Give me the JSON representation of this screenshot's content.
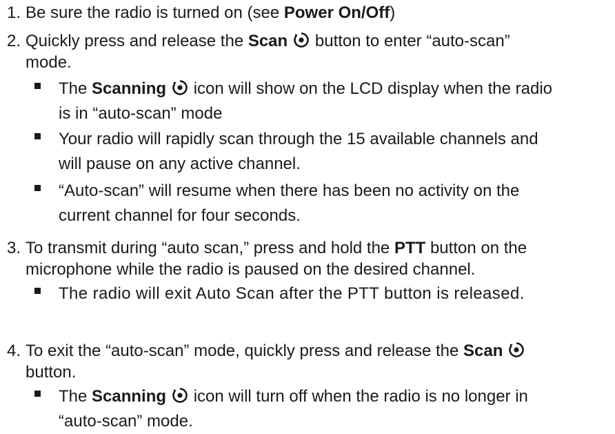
{
  "steps": [
    {
      "num": "1.",
      "pre": "Be sure the radio is turned on (see ",
      "bold": "Power On/Off",
      "post": ")"
    },
    {
      "num": "2.",
      "pre": "Quickly press and release the ",
      "bold": "Scan",
      "post": " button to enter “auto-scan”",
      "line2": "mode."
    },
    {
      "num": "3.",
      "line1": "To transmit during “auto scan,” press and hold the ",
      "bold": "PTT",
      "line1b": " button on the",
      "line2": "microphone while the radio is paused on the desired channel."
    },
    {
      "num": "4.",
      "pre": "To exit the “auto-scan” mode, quickly press and release the ",
      "bold": "Scan",
      "line2": "button."
    }
  ],
  "bullets_step2": [
    {
      "pre": "The ",
      "bold": "Scanning",
      "post": " icon will show on the LCD display when the radio",
      "line2": "is in “auto-scan” mode"
    },
    {
      "line1": "Your radio will rapidly scan through the 15 available channels and",
      "line2": "will pause on any active channel."
    },
    {
      "line1": "“Auto-scan” will resume when there has been no activity on the",
      "line2": "current channel for four seconds."
    }
  ],
  "bullets_step3": [
    {
      "line1": "The radio will exit Auto Scan after the PTT button is released."
    }
  ],
  "bullets_step4": [
    {
      "pre": "The ",
      "bold": "Scanning",
      "post": " icon will turn off when the radio is no longer in",
      "line2": "“auto-scan” mode."
    }
  ],
  "icon": "scan-icon"
}
